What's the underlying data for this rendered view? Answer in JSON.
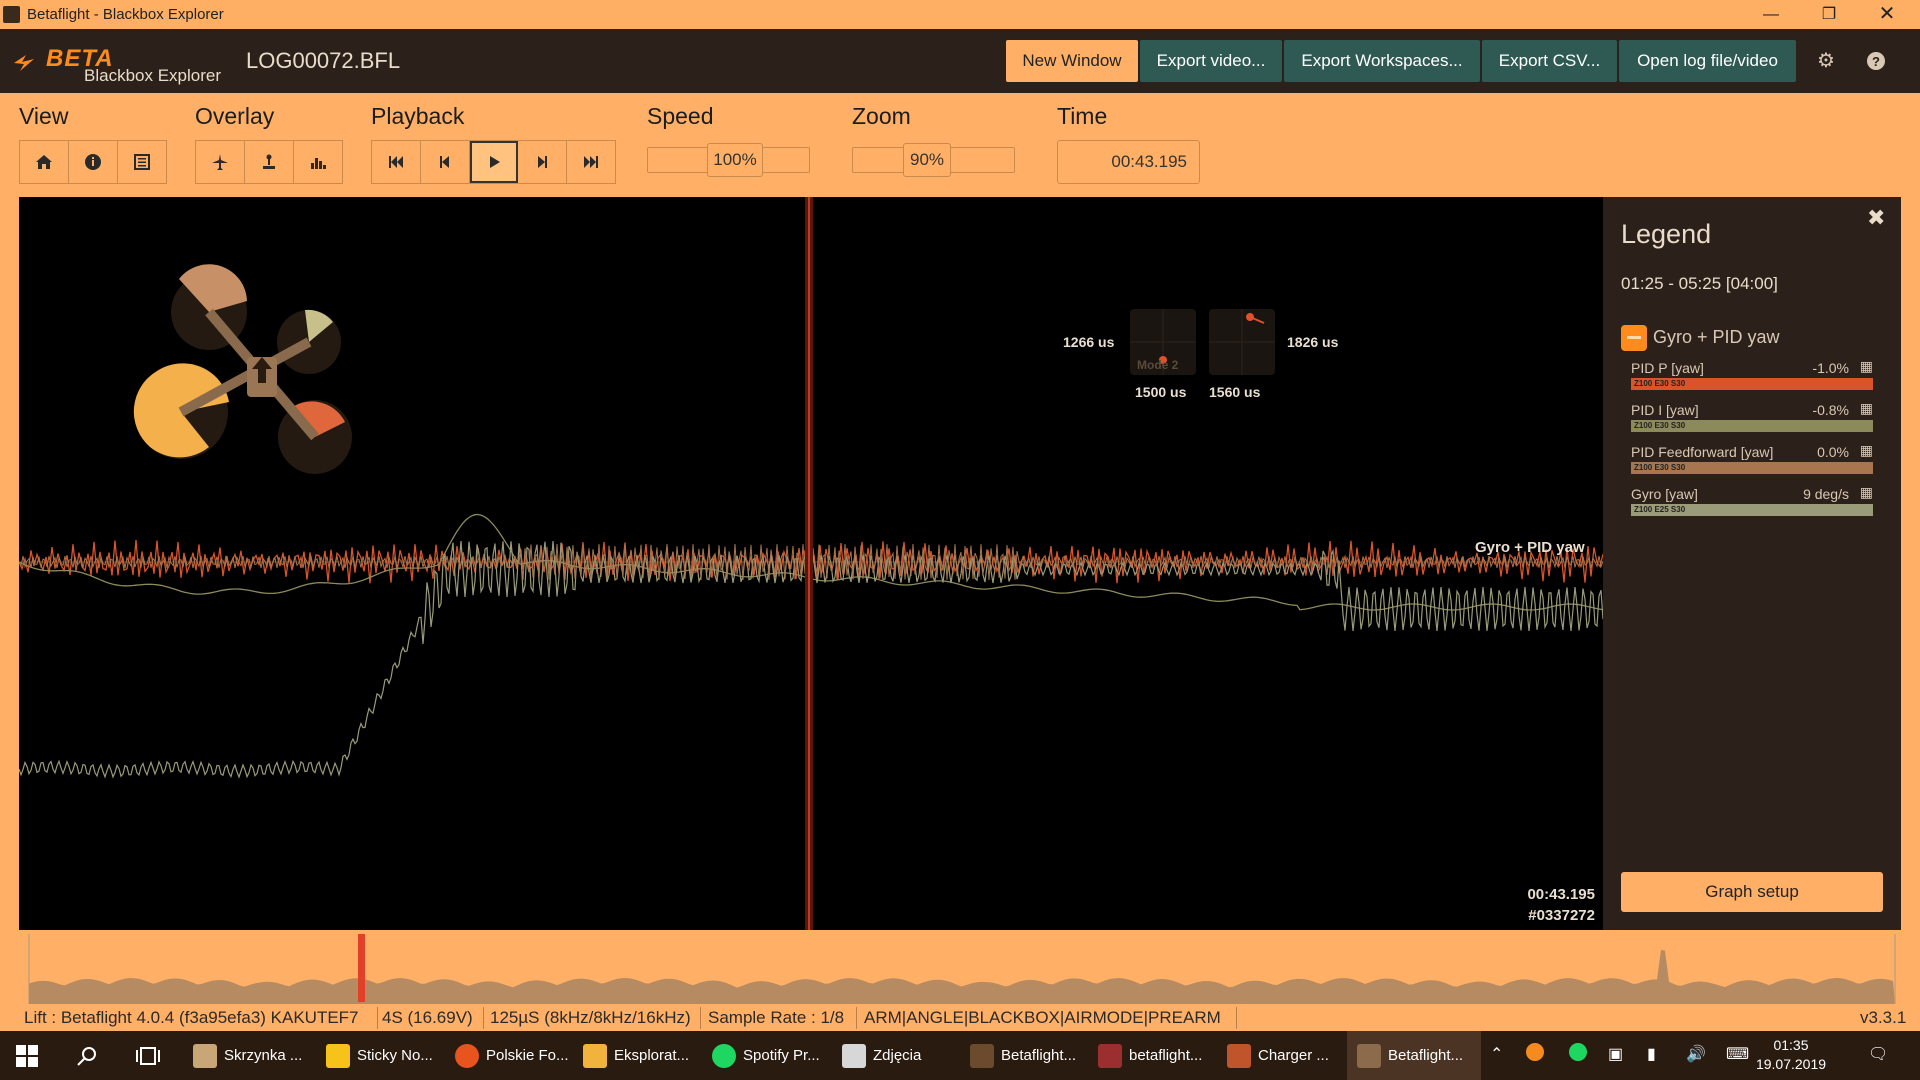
{
  "window": {
    "title": "Betaflight - Blackbox Explorer",
    "controls": [
      "minimize-icon",
      "restore-icon",
      "close-icon"
    ]
  },
  "header": {
    "logo_beta": "BETA",
    "logo_sub": "Blackbox Explorer",
    "log_file": "LOG00072.BFL",
    "buttons": [
      "New Window",
      "Export video...",
      "Export Workspaces...",
      "Export CSV...",
      "Open log file/video"
    ],
    "icons": [
      "gear-icon",
      "help-icon"
    ]
  },
  "toolbar": {
    "view_label": "View",
    "overlay_label": "Overlay",
    "playback_label": "Playback",
    "speed_label": "Speed",
    "zoom_label": "Zoom",
    "time_label": "Time",
    "speed_value": "100%",
    "zoom_value": "90%",
    "time_value": "00:43.195"
  },
  "graph": {
    "stick_left_x": "1266 us",
    "stick_left_y": "1500 us",
    "stick_right_x": "1826 us",
    "stick_right_y": "1560 us",
    "mode_label": "Mode 2",
    "series_label": "Gyro + PID yaw",
    "time": "00:43.195",
    "frame": "#0337272",
    "colors": {
      "pid_p": "#d9532b",
      "pid_i": "#8c8a5a",
      "feedforward": "#a7764e",
      "gyro": "#9a9b78",
      "cursor": "#c0392b"
    }
  },
  "legend": {
    "title": "Legend",
    "range": "01:25 - 05:25 [04:00]",
    "group_name": "Gyro + PID yaw",
    "items": [
      {
        "name": "PID P [yaw]",
        "value": "-1.0%",
        "scale": "Z100 E30 S30",
        "color": "#d9532b"
      },
      {
        "name": "PID I [yaw]",
        "value": "-0.8%",
        "scale": "Z100 E30 S30",
        "color": "#8c8a5a"
      },
      {
        "name": "PID Feedforward [yaw]",
        "value": "0.0%",
        "scale": "Z100 E30 S30",
        "color": "#a7764e"
      },
      {
        "name": "Gyro [yaw]",
        "value": "9 deg/s",
        "scale": "Z100 E25 S30",
        "color": "#9a9b78"
      }
    ],
    "graph_setup": "Graph setup"
  },
  "status": {
    "firmware": "Lift : Betaflight 4.0.4 (f3a95efa3) KAKUTEF7",
    "battery": "4S (16.69V)",
    "loop": "125µS (8kHz/8kHz/16kHz)",
    "sample": "Sample Rate : 1/8",
    "flags": "ARM|ANGLE|BLACKBOX|AIRMODE|PREARM",
    "version": "v3.3.1"
  },
  "taskbar": {
    "apps": [
      "Skrzynka ...",
      "Sticky No...",
      "Polskie Fo...",
      "Eksplorat...",
      "Spotify Pr...",
      "Zdjęcia",
      "Betaflight...",
      "betaflight...",
      "Charger ...",
      "Betaflight..."
    ],
    "time": "01:35",
    "date": "19.07.2019"
  }
}
